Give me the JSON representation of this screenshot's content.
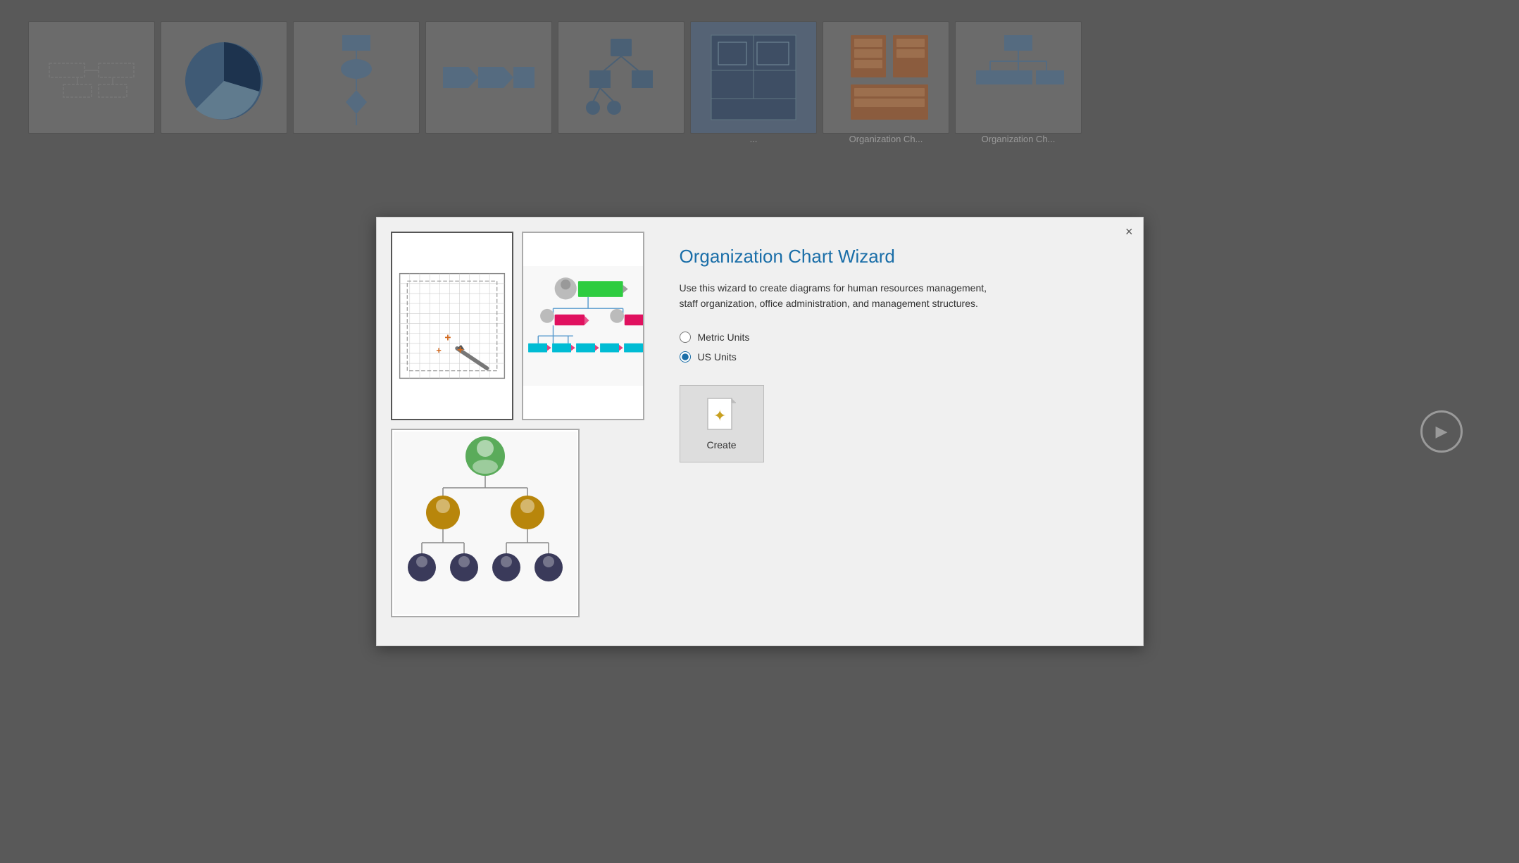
{
  "background": {
    "thumbnails": [
      {
        "id": "basic",
        "label": ""
      },
      {
        "id": "pie",
        "label": ""
      },
      {
        "id": "flowchart",
        "label": ""
      },
      {
        "id": "process",
        "label": ""
      },
      {
        "id": "network",
        "label": ""
      },
      {
        "id": "blueprint",
        "label": "..."
      },
      {
        "id": "rack",
        "label": "Organization Ch..."
      },
      {
        "id": "org",
        "label": "Organization Ch..."
      }
    ]
  },
  "modal": {
    "title": "Organization Chart Wizard",
    "description": "Use this wizard to create diagrams for human resources management, staff organization, office administration, and management structures.",
    "close_label": "×",
    "units": {
      "metric_label": "Metric Units",
      "us_label": "US Units",
      "selected": "us"
    },
    "create_button_label": "Create"
  },
  "play_button": {
    "label": "▶"
  }
}
